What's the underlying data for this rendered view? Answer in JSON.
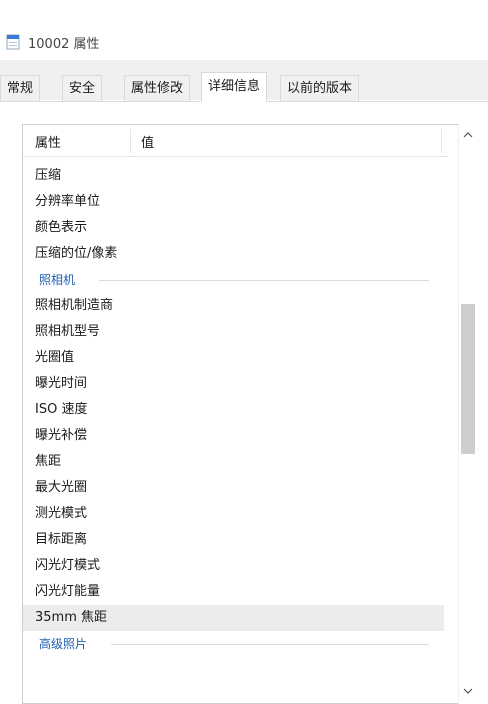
{
  "window": {
    "title": "10002 属性"
  },
  "tabs": [
    {
      "label": "常规"
    },
    {
      "label": "安全"
    },
    {
      "label": "属性修改"
    },
    {
      "label": "详细信息"
    },
    {
      "label": "以前的版本"
    }
  ],
  "active_tab": "详细信息",
  "list": {
    "columns": {
      "property": "属性",
      "value": "值"
    },
    "rows": [
      {
        "type": "item",
        "label": "压缩"
      },
      {
        "type": "item",
        "label": "分辨率单位"
      },
      {
        "type": "item",
        "label": "颜色表示"
      },
      {
        "type": "item",
        "label": "压缩的位/像素"
      },
      {
        "type": "group",
        "label": "照相机"
      },
      {
        "type": "item",
        "label": "照相机制造商"
      },
      {
        "type": "item",
        "label": "照相机型号"
      },
      {
        "type": "item",
        "label": "光圈值"
      },
      {
        "type": "item",
        "label": "曝光时间"
      },
      {
        "type": "item",
        "label": "ISO 速度"
      },
      {
        "type": "item",
        "label": "曝光补偿"
      },
      {
        "type": "item",
        "label": "焦距"
      },
      {
        "type": "item",
        "label": "最大光圈"
      },
      {
        "type": "item",
        "label": "测光模式"
      },
      {
        "type": "item",
        "label": "目标距离"
      },
      {
        "type": "item",
        "label": "闪光灯模式"
      },
      {
        "type": "item",
        "label": "闪光灯能量"
      },
      {
        "type": "item",
        "label": "35mm 焦距",
        "selected": true
      },
      {
        "type": "group",
        "label": "高级照片"
      }
    ]
  },
  "scrollbar": {
    "up_icon": "chevron-up-icon",
    "down_icon": "chevron-down-icon"
  }
}
